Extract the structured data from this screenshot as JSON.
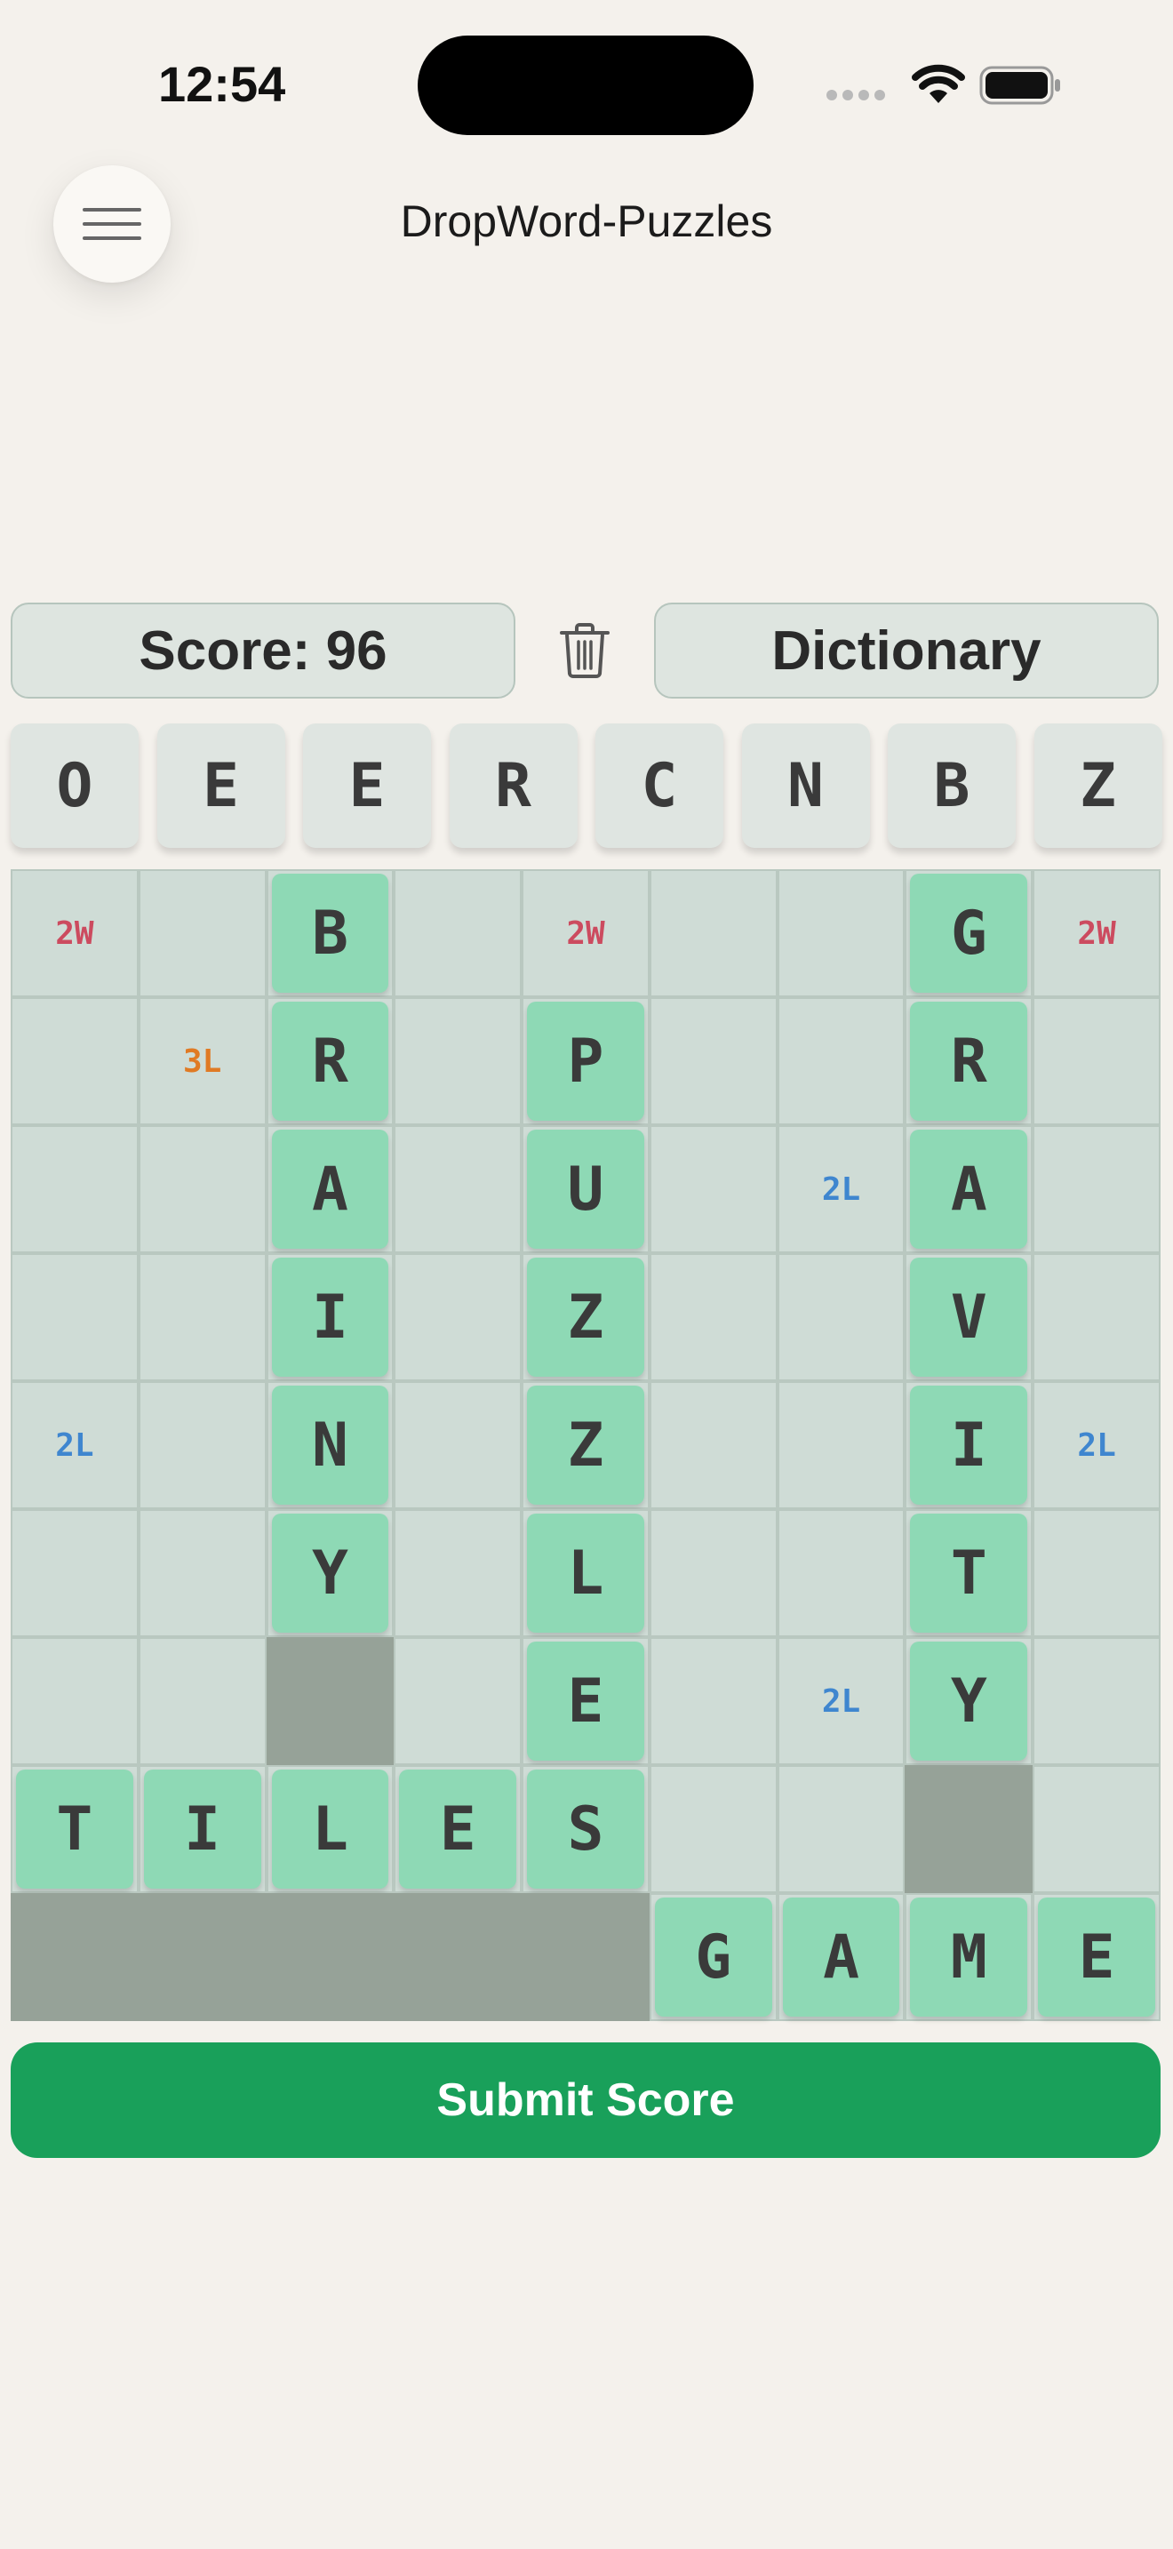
{
  "status_bar": {
    "time": "12:54"
  },
  "header": {
    "title": "DropWord-Puzzles",
    "menu_icon": "hamburger-icon"
  },
  "toolbar": {
    "score_label": "Score: 96",
    "dictionary_label": "Dictionary",
    "trash_icon": "trash-icon"
  },
  "letter_tray": [
    "O",
    "E",
    "E",
    "R",
    "C",
    "N",
    "B",
    "Z"
  ],
  "board": {
    "columns": 9,
    "rows": 9,
    "grid": [
      [
        "2W",
        "",
        "B",
        "",
        "2W",
        "",
        "",
        "G",
        "2W"
      ],
      [
        "",
        "3L",
        "R",
        "",
        "P",
        "",
        "",
        "R",
        ""
      ],
      [
        "",
        "",
        "A",
        "",
        "U",
        "",
        "2L",
        "A",
        ""
      ],
      [
        "",
        "",
        "I",
        "",
        "Z",
        "",
        "",
        "V",
        ""
      ],
      [
        "2L",
        "",
        "N",
        "",
        "Z",
        "",
        "",
        "I",
        "2L"
      ],
      [
        "",
        "",
        "Y",
        "",
        "L",
        "",
        "",
        "T",
        ""
      ],
      [
        "",
        "",
        "#",
        "",
        "E",
        "",
        "2L",
        "Y",
        ""
      ],
      [
        "T",
        "I",
        "L",
        "E",
        "S",
        "",
        "",
        "#",
        ""
      ],
      [
        "#",
        "#",
        "#",
        "#",
        "#",
        "G",
        "A",
        "M",
        "E"
      ]
    ],
    "bonus_colors": {
      "2W": "#cc4b5f",
      "3L": "#e07a24",
      "2L": "#3f86cf"
    }
  },
  "actions": {
    "submit_label": "Submit Score"
  },
  "colors": {
    "accent": "#19a05a",
    "tile": "#8ed9b5",
    "background": "#f4f1ec"
  }
}
